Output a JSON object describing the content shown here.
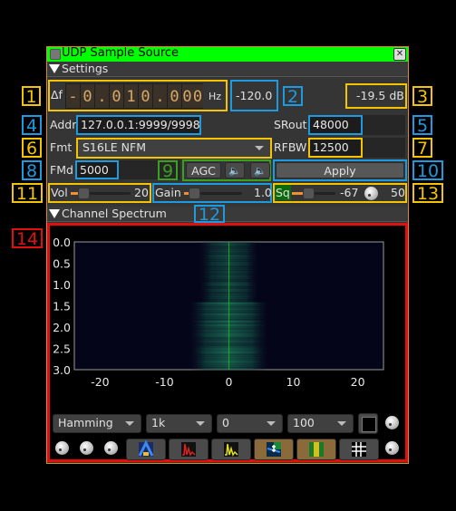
{
  "window": {
    "title": "UDP Sample Source",
    "close_icon": "close-box-icon",
    "title_bar_color": "#00ff00",
    "border_color": "#e08a1e"
  },
  "settings": {
    "section_label": "Settings",
    "delta_f_label": "Δf",
    "frequency_sign": "-",
    "frequency_digits": [
      "0",
      ".",
      "0",
      "1",
      "0",
      ".",
      "0",
      "0",
      "0"
    ],
    "frequency_unit": "Hz",
    "channel_power": "-120.0",
    "squelch_level_db": "-19.5  dB",
    "addr_label": "Addr",
    "addr_value": "127.0.0.1:9999/9998",
    "srout_label": "SRout",
    "srout_value": "48000",
    "fmt_label": "Fmt",
    "fmt_value": "S16LE NFM",
    "rfbw_label": "RFBW",
    "rfbw_value": "12500",
    "fmd_label": "FMd",
    "fmd_value": "5000",
    "agc_label": "AGC",
    "apply_label": "Apply",
    "vol_label": "Vol",
    "vol_value": "20",
    "vol_fraction": 0.1,
    "gain_label": "Gain",
    "gain_value": "1.0",
    "gain_fraction": 0.05,
    "sq_label": "Sq",
    "sq_value": "-67",
    "sq_fraction": 0.25,
    "sq_gate_value": "50"
  },
  "spectrum": {
    "section_label": "Channel Spectrum",
    "window_options": {
      "selected": "Hamming"
    },
    "fft_size": {
      "selected": "1k"
    },
    "ref_level": {
      "selected": "0"
    },
    "range": {
      "selected": "100"
    },
    "buttons": [
      "waterfall-3d",
      "spectrum-max-hold",
      "spectrum-current",
      "spectrum-histogram",
      "waterfall",
      "grid"
    ]
  },
  "chart_data": {
    "type": "heatmap",
    "title": "",
    "xlabel": "",
    "ylabel": "",
    "x_ticks": [
      "-20",
      "-10",
      "0",
      "10",
      "20"
    ],
    "y_ticks": [
      "0.0",
      "0.5",
      "1.0",
      "1.5",
      "2.0",
      "2.5",
      "3.0"
    ],
    "xlim": [
      -24,
      24
    ],
    "ylim": [
      0,
      3
    ],
    "signal_band": [
      -6,
      6
    ],
    "center_line": 0,
    "grid": false,
    "colors": {
      "background": "#05051a",
      "signal": "#1d7a5a",
      "center": "#18c018"
    }
  },
  "annotations": {
    "badges": [
      "1",
      "2",
      "3",
      "4",
      "5",
      "6",
      "7",
      "8",
      "9",
      "10",
      "11",
      "12",
      "13",
      "14"
    ]
  }
}
